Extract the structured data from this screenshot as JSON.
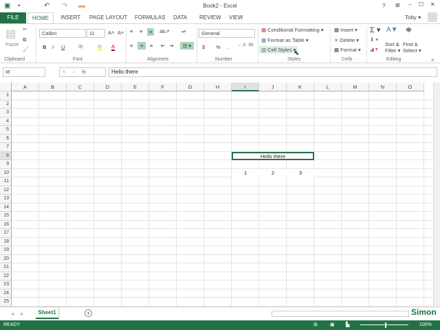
{
  "window": {
    "title": "Book2 - Excel",
    "help": "?",
    "user": "Toby ▾"
  },
  "tabs": {
    "file": "FILE",
    "items": [
      "HOME",
      "INSERT",
      "PAGE LAYOUT",
      "FORMULAS",
      "DATA",
      "REVIEW",
      "VIEW"
    ]
  },
  "ribbon": {
    "clipboard": {
      "paste": "Paste",
      "label": "Clipboard"
    },
    "font": {
      "name": "Calibri",
      "size": "11",
      "bold": "B",
      "italic": "I",
      "underline": "U",
      "label": "Font"
    },
    "alignment": {
      "label": "Alignment"
    },
    "number": {
      "format": "General",
      "currency": "$",
      "percent": "%",
      "comma": ",",
      "label": "Number"
    },
    "styles": {
      "conditional": "Conditional Formatting ▾",
      "format_table": "Format as Table ▾",
      "cell_styles": "Cell Styles ▾",
      "label": "Styles"
    },
    "cells": {
      "insert": "Insert ▾",
      "delete": "Delete ▾",
      "format": "Format ▾",
      "label": "Cells"
    },
    "editing": {
      "sort1": "Sort &",
      "sort2": "Filter ▾",
      "find1": "Find &",
      "find2": "Select ▾",
      "label": "Editing"
    }
  },
  "formula_bar": {
    "name_box": "I8",
    "fx": "fx",
    "value": "Hello there"
  },
  "sheet": {
    "columns": [
      "A",
      "B",
      "C",
      "D",
      "E",
      "F",
      "G",
      "H",
      "I",
      "J",
      "K",
      "L",
      "M",
      "N",
      "O"
    ],
    "rows": 25,
    "selected_col": "I",
    "selected_row": 8,
    "cells": [
      {
        "ref": "I8",
        "col": 8,
        "row": 8,
        "span": 3,
        "value": "Hello there"
      },
      {
        "ref": "I10",
        "col": 8,
        "row": 10,
        "value": "1"
      },
      {
        "ref": "J10",
        "col": 9,
        "row": 10,
        "value": "2"
      },
      {
        "ref": "K10",
        "col": 10,
        "row": 10,
        "value": "3"
      }
    ]
  },
  "sheet_tabs": {
    "active": "Sheet1",
    "add": "+"
  },
  "status": {
    "state": "READY",
    "zoom": "100%"
  },
  "watermark": "Simon"
}
